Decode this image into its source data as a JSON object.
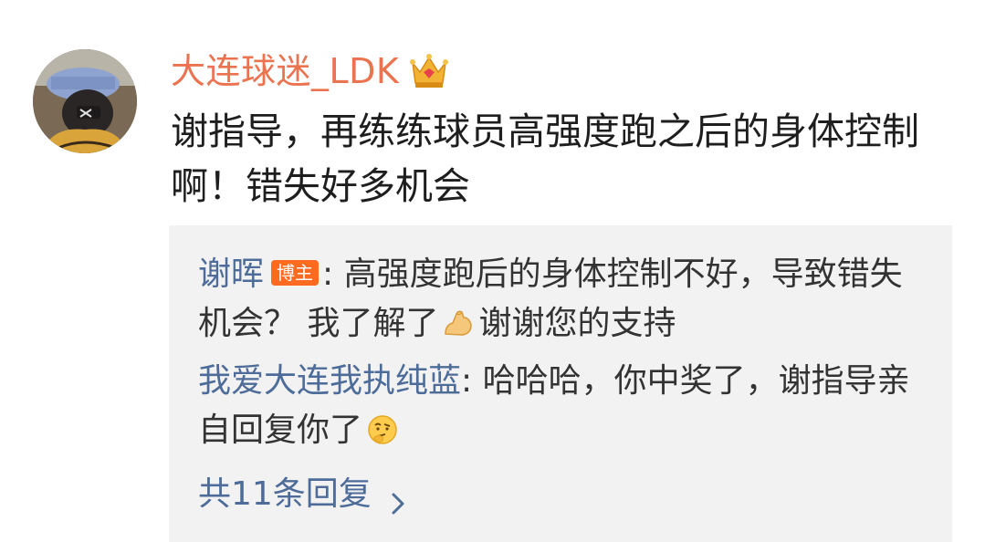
{
  "comment": {
    "username": "大连球迷_LDK",
    "user_badge_icon": "crown-icon",
    "text": "谢指导，再练练球员高强度跑之后的身体控制啊！错失好多机会"
  },
  "replies": [
    {
      "author": "谢晖",
      "badge": "博主",
      "separator": ": ",
      "text_before_emoji": "高强度跑后的身体控制不好，导致错失机会？ 我了解了",
      "emoji": "flexed-biceps-icon",
      "text_after_emoji": "谢谢您的支持"
    },
    {
      "author": "我爱大连我执纯蓝",
      "separator": ": ",
      "text_before_emoji": "哈哈哈，你中奖了，谢指导亲自回复你了",
      "emoji": "thinking-face-icon"
    }
  ],
  "more_replies_label": "共11条回复",
  "colors": {
    "username": "#eb7350",
    "link": "#4d6c99",
    "badge": "#ff6a21",
    "reply_box": "#f2f2f2"
  }
}
